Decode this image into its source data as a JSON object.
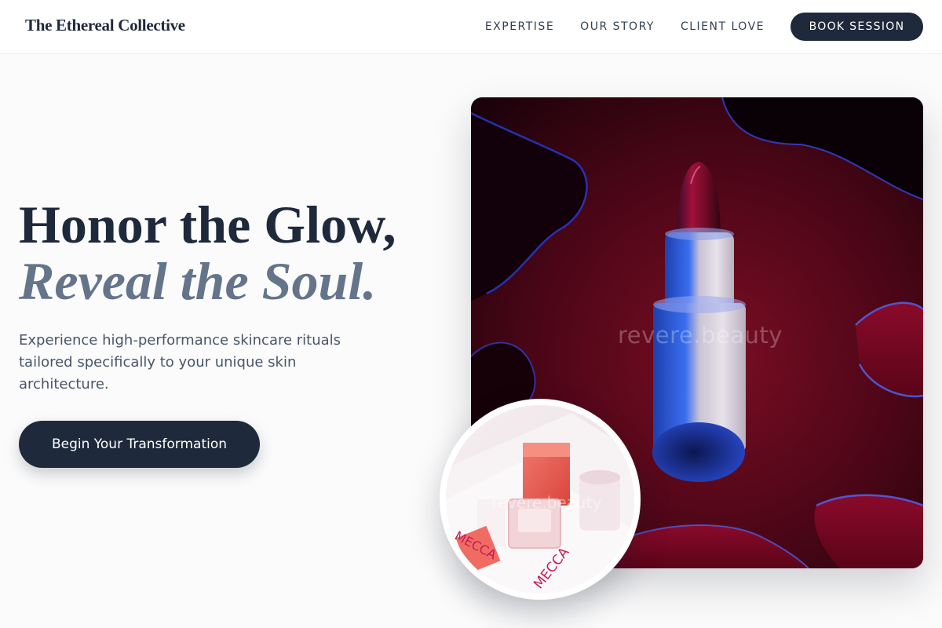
{
  "nav": {
    "brand": "The Ethereal Collective",
    "links": [
      "EXPERTISE",
      "OUR STORY",
      "CLIENT LOVE"
    ],
    "cta": "BOOK SESSION"
  },
  "hero": {
    "title_line1": "Honor the Glow,",
    "title_line2": "Reveal the Soul.",
    "subtitle": "Experience high-performance skincare rituals tailored specifically to your unique skin architecture.",
    "button": "Begin Your Transformation"
  },
  "images": {
    "main_watermark": "revere.beauty",
    "circle_watermark": "revere.beauty",
    "product_text_1": "MECCA",
    "product_text_2": "MECCA"
  },
  "colors": {
    "primary": "#1e293b",
    "accent_text": "#64748b",
    "body_text": "#475569"
  }
}
